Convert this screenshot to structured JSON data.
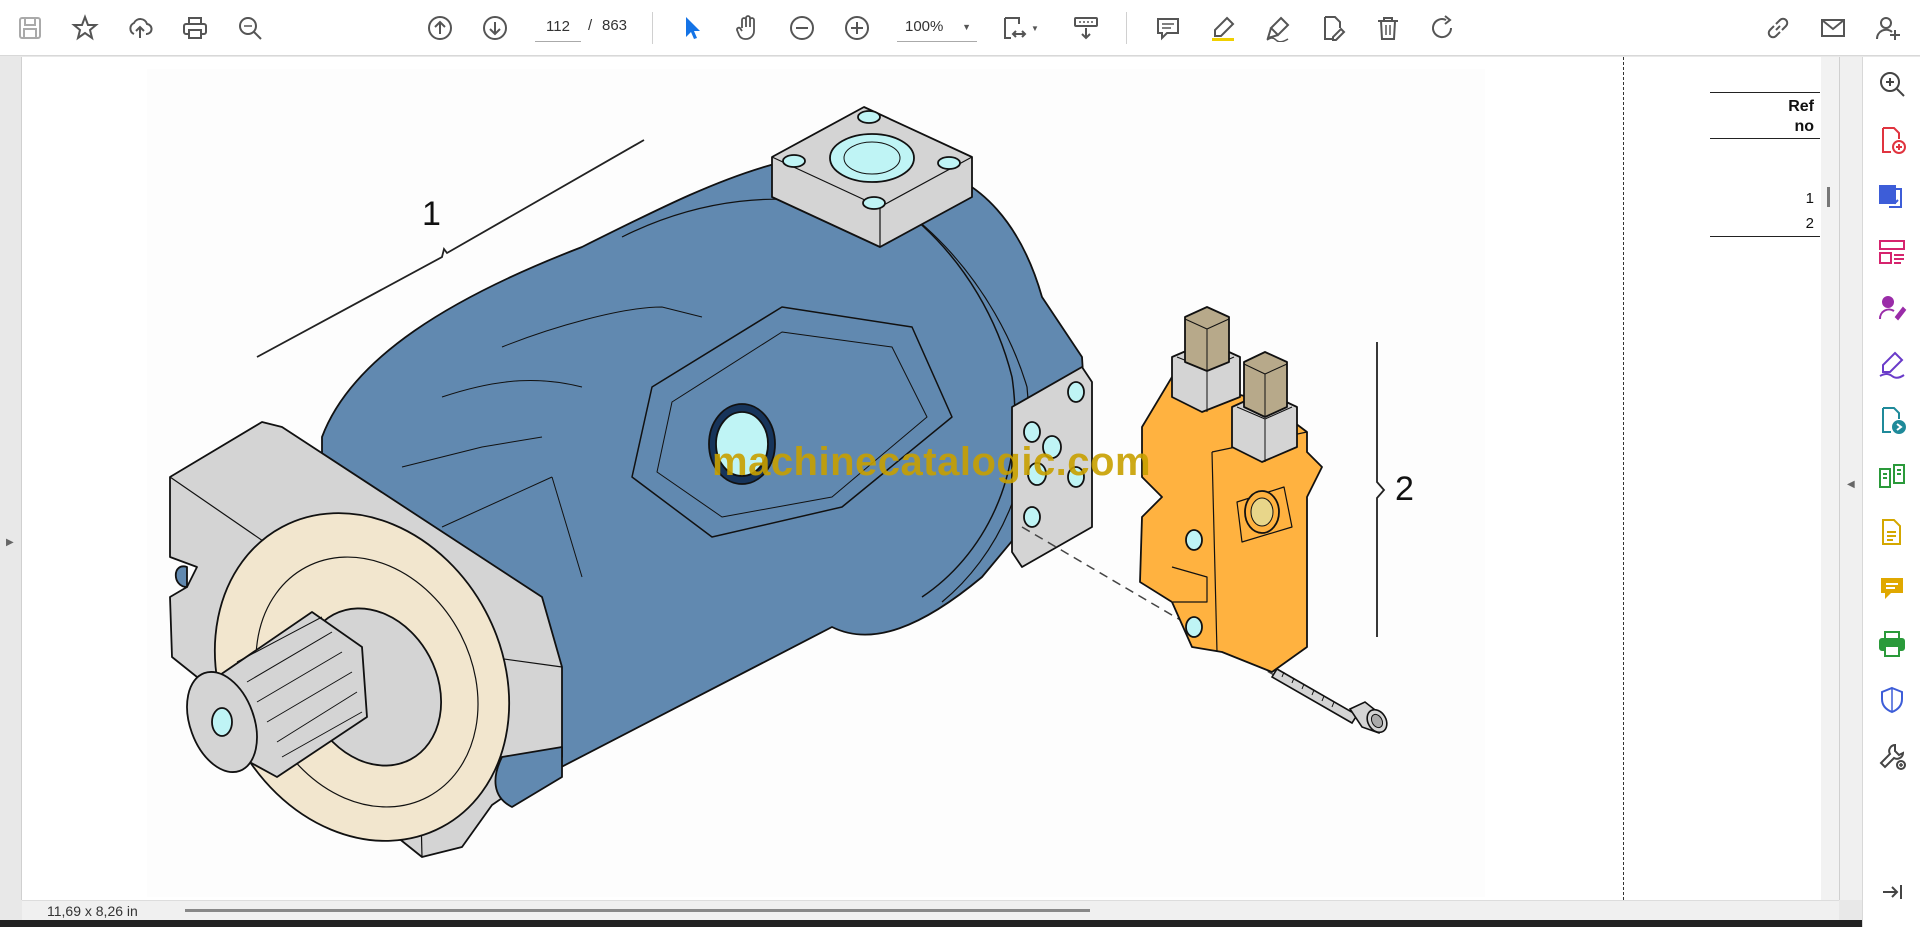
{
  "toolbar": {
    "page_current": "112",
    "page_separator": "/",
    "page_total": "863",
    "zoom": "100%",
    "buttons": [
      {
        "name": "save-icon"
      },
      {
        "name": "star-icon"
      },
      {
        "name": "upload-cloud-icon"
      },
      {
        "name": "print-icon"
      },
      {
        "name": "search-icon"
      },
      {
        "name": "prev-page-icon"
      },
      {
        "name": "next-page-icon"
      },
      {
        "name": "select-cursor-icon"
      },
      {
        "name": "hand-tool-icon"
      },
      {
        "name": "zoom-out-icon"
      },
      {
        "name": "zoom-in-icon"
      },
      {
        "name": "fit-page-icon"
      },
      {
        "name": "scroll-mode-icon"
      },
      {
        "name": "comment-icon"
      },
      {
        "name": "highlight-icon"
      },
      {
        "name": "sign-pen-icon"
      },
      {
        "name": "edit-document-icon"
      },
      {
        "name": "delete-icon"
      },
      {
        "name": "rotate-icon"
      },
      {
        "name": "share-link-icon"
      },
      {
        "name": "email-icon"
      },
      {
        "name": "user-account-icon"
      }
    ]
  },
  "document": {
    "callouts": [
      "1",
      "2"
    ],
    "watermark": "machinecatalogic.com",
    "ref_table": {
      "header_line1": "Ref",
      "header_line2": "no",
      "rows": [
        "1",
        "2"
      ]
    }
  },
  "tools_panel": [
    {
      "name": "zoom-search-icon",
      "color": "#444444"
    },
    {
      "name": "create-pdf-icon",
      "color": "#e0343f"
    },
    {
      "name": "export-pdf-icon",
      "color": "#3d5dd8"
    },
    {
      "name": "organize-pages-icon",
      "color": "#d6246e"
    },
    {
      "name": "request-signature-icon",
      "color": "#9a2ca8"
    },
    {
      "name": "fill-sign-icon",
      "color": "#6a3bc9"
    },
    {
      "name": "send-for-review-icon",
      "color": "#1f8a9a"
    },
    {
      "name": "compare-files-icon",
      "color": "#2a9a3a"
    },
    {
      "name": "stamp-icon",
      "color": "#d4a700"
    },
    {
      "name": "comment-panel-icon",
      "color": "#e0a800"
    },
    {
      "name": "print-production-icon",
      "color": "#2a9a3a"
    },
    {
      "name": "protect-icon",
      "color": "#3d5dd8"
    },
    {
      "name": "more-tools-icon",
      "color": "#444444"
    },
    {
      "name": "collapse-panel-icon",
      "color": "#444444"
    }
  ],
  "status": {
    "page_size": "11,69 x 8,26 in"
  },
  "colors": {
    "motor_body": "#6189b0",
    "flange": "#d4d4d4",
    "valve_block": "#ffb240",
    "port": "#bff4f5",
    "seal": "#f2e6ce"
  }
}
